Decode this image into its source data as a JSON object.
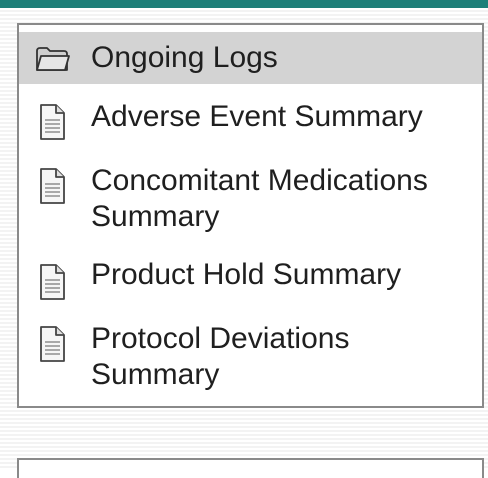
{
  "tree": {
    "items": [
      {
        "label": "Ongoing Logs",
        "icon": "folder-icon",
        "selected": true
      },
      {
        "label": "Adverse Event Summary",
        "icon": "document-icon",
        "selected": false
      },
      {
        "label": "Concomitant Medications\nSummary",
        "icon": "document-icon",
        "selected": false
      },
      {
        "label": "Product Hold Summary",
        "icon": "document-icon",
        "selected": false
      },
      {
        "label": "Protocol Deviations\nSummary",
        "icon": "document-icon",
        "selected": false
      }
    ]
  },
  "colors": {
    "accent_bar": "#1e7f79",
    "selected_bg": "#d3d3d3",
    "panel_border": "#8a8a8a",
    "text": "#1f1f1f"
  }
}
